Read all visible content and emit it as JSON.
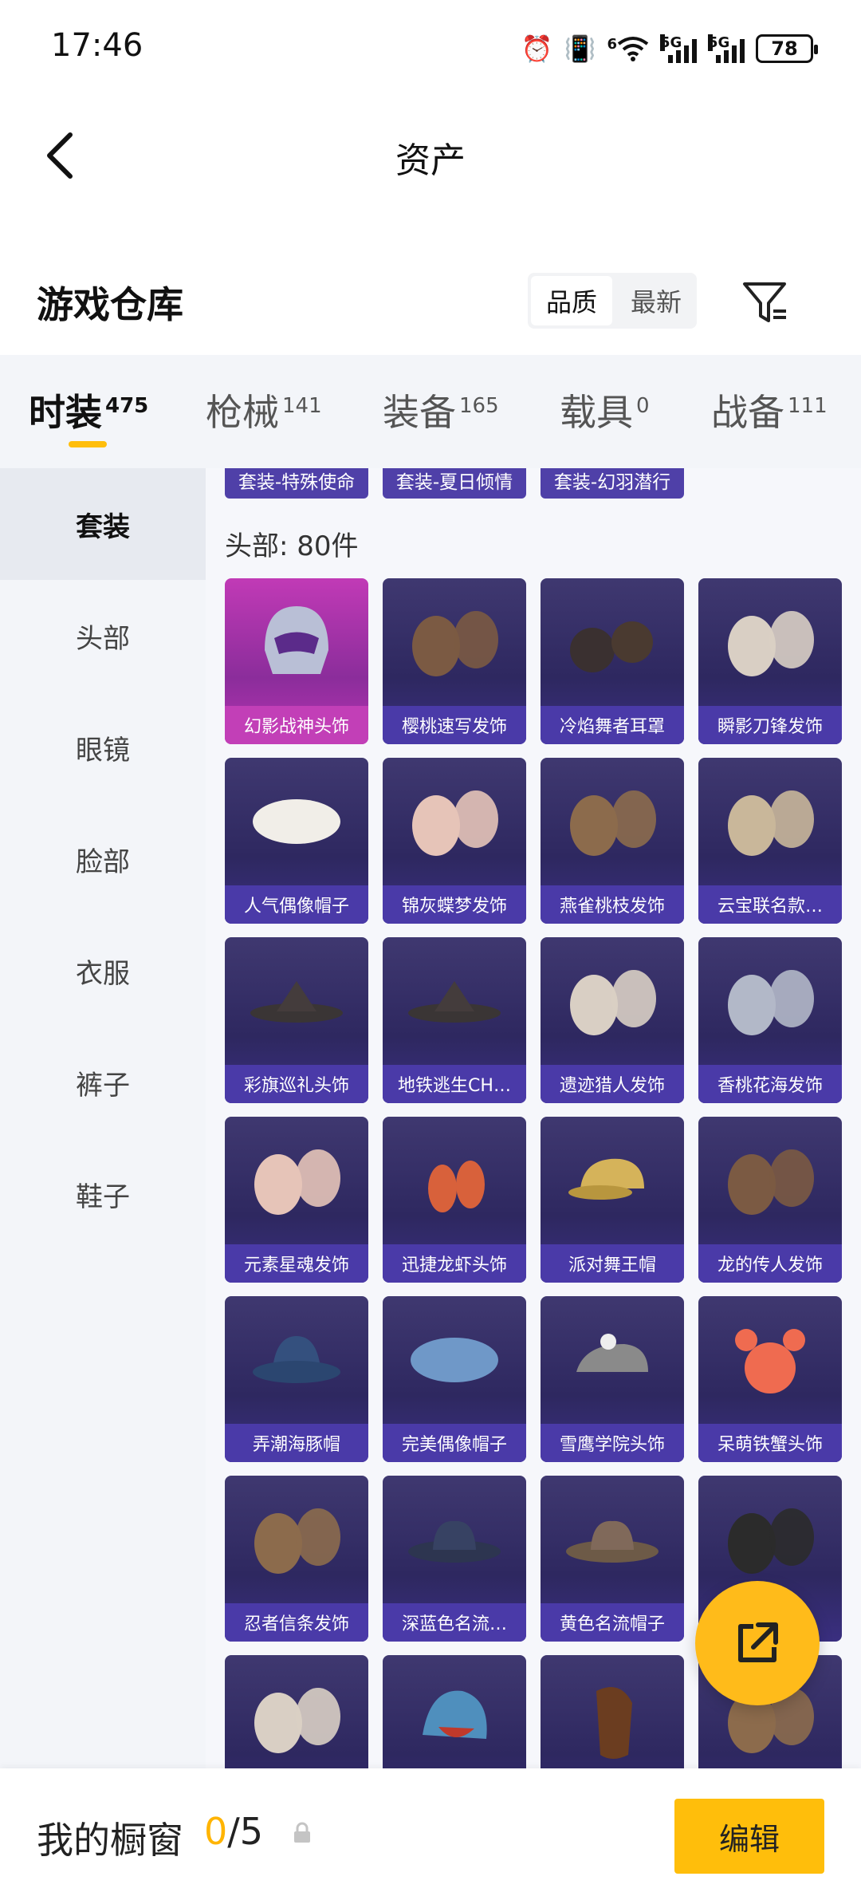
{
  "status": {
    "time": "17:46",
    "battery": "78",
    "sig1": "5G",
    "sig2": "5G",
    "wifi_tag": "6"
  },
  "nav": {
    "title": "资产"
  },
  "section": {
    "title": "游戏仓库",
    "sort_options": [
      "品质",
      "最新"
    ]
  },
  "categories": [
    {
      "label": "时装",
      "count": "475"
    },
    {
      "label": "枪械",
      "count": "141"
    },
    {
      "label": "装备",
      "count": "165"
    },
    {
      "label": "载具",
      "count": "0"
    },
    {
      "label": "战备",
      "count": "111"
    }
  ],
  "sidebar": [
    "套装",
    "头部",
    "眼镜",
    "脸部",
    "衣服",
    "裤子",
    "鞋子"
  ],
  "suits": [
    "套装-特殊使命",
    "套装-夏日倾情",
    "套装-幻羽潜行"
  ],
  "head_count": "头部: 80件",
  "items": [
    "幻影战神头饰",
    "樱桃速写发饰",
    "冷焰舞者耳罩",
    "瞬影刀锋发饰",
    "人气偶像帽子",
    "锦灰蝶梦发饰",
    "燕雀桃枝发饰",
    "云宝联名款…",
    "彩旗巡礼头饰",
    "地铁逃生CH…",
    "遗迹猎人发饰",
    "香桃花海发饰",
    "元素星魂发饰",
    "迅捷龙虾头饰",
    "派对舞王帽",
    "龙的传人发饰",
    "弄潮海豚帽",
    "完美偶像帽子",
    "雪鹰学院头饰",
    "呆萌铁蟹头饰",
    "忍者信条发饰",
    "深蓝色名流…",
    "黄色名流帽子",
    "",
    "",
    "",
    "",
    ""
  ],
  "showcase": {
    "label": "我的橱窗",
    "current": "0",
    "total": "/5"
  },
  "edit_label": "编辑",
  "colors": {
    "accent": "#ffbe0b",
    "card_label": "#4a3aa8",
    "legend": "#c23fb7"
  }
}
